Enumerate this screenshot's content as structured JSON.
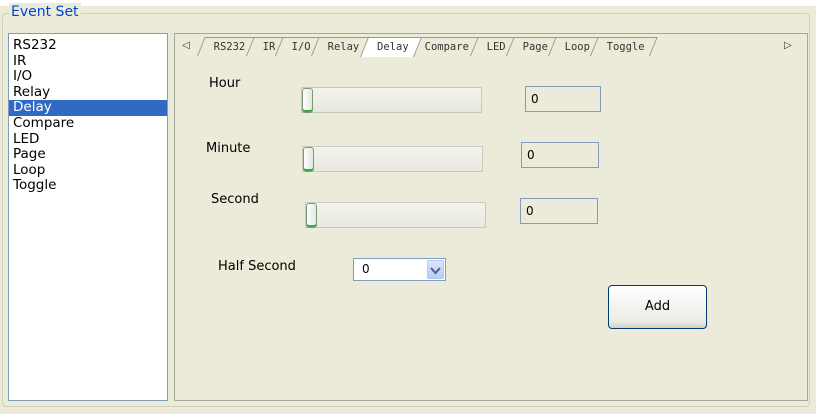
{
  "group": {
    "title": "Event Set"
  },
  "list": {
    "items": [
      "RS232",
      "IR",
      "I/O",
      "Relay",
      "Delay",
      "Compare",
      "LED",
      "Page",
      "Loop",
      "Toggle"
    ],
    "selected": "Delay"
  },
  "tabs": {
    "items": [
      "RS232",
      "IR",
      "I/O",
      "Relay",
      "Delay",
      "Compare",
      "LED",
      "Page",
      "Loop",
      "Toggle"
    ],
    "active": "Delay",
    "left_arrow": "◁",
    "right_arrow": "▷"
  },
  "delay": {
    "hour": {
      "label": "Hour",
      "value": "0",
      "slider_level": 0
    },
    "minute": {
      "label": "Minute",
      "value": "0",
      "slider_level": 0
    },
    "second": {
      "label": "Second",
      "value": "0",
      "slider_level": 0
    },
    "half_second": {
      "label": "Half Second",
      "selected": "0",
      "dropdown_icon": "chevron-down-icon"
    }
  },
  "add_button": {
    "label": "Add"
  },
  "colors": {
    "legend": "#0046d5",
    "selection": "#316ac5",
    "thumb_accent": "#3ca83c"
  }
}
